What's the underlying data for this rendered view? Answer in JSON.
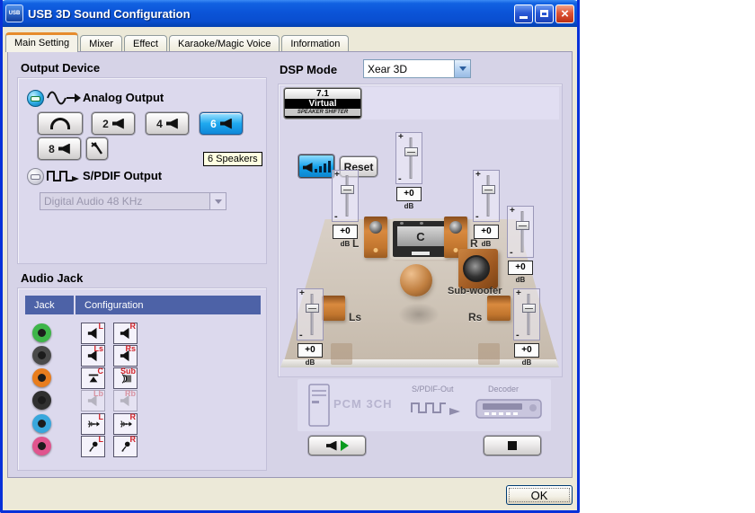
{
  "window": {
    "title": "USB 3D Sound Configuration"
  },
  "tabs": [
    {
      "label": "Main Setting",
      "active": true
    },
    {
      "label": "Mixer"
    },
    {
      "label": "Effect"
    },
    {
      "label": "Karaoke/Magic Voice"
    },
    {
      "label": "Information"
    }
  ],
  "output_device": {
    "heading": "Output Device",
    "analog_label": "Analog Output",
    "speaker_buttons": [
      {
        "icon": "headphone"
      },
      {
        "label": "2"
      },
      {
        "label": "4"
      },
      {
        "label": "6",
        "selected": true
      },
      {
        "label": "8"
      },
      {
        "icon": "settings-wrench"
      }
    ],
    "tooltip": "6 Speakers",
    "spdif_label": "S/PDIF Output",
    "spdif_format": "Digital Audio 48 KHz",
    "spdif_format_disabled": true
  },
  "audio_jack": {
    "heading": "Audio Jack",
    "columns": [
      "Jack",
      "Configuration"
    ],
    "rows": [
      {
        "jack_color": "#3eb549",
        "icons": [
          {
            "type": "speaker",
            "label": "L"
          },
          {
            "type": "speaker",
            "label": "R"
          }
        ]
      },
      {
        "jack_color": "#4a4a4a",
        "icons": [
          {
            "type": "speaker",
            "label": "Ls"
          },
          {
            "type": "speaker",
            "label": "Rs"
          }
        ]
      },
      {
        "jack_color": "#e87d1e",
        "icons": [
          {
            "type": "center-speaker",
            "label": "C"
          },
          {
            "type": "subwoofer",
            "label": "Sub"
          }
        ]
      },
      {
        "jack_color": "#303030",
        "disabled": true,
        "icons": [
          {
            "type": "speaker",
            "label": "Lb"
          },
          {
            "type": "speaker",
            "label": "Rb"
          }
        ]
      },
      {
        "jack_color": "#39a7dc",
        "icons": [
          {
            "type": "line-in",
            "label": "L"
          },
          {
            "type": "line-in",
            "label": "R"
          }
        ]
      },
      {
        "jack_color": "#e0558e",
        "icons": [
          {
            "type": "microphone",
            "label": "L"
          },
          {
            "type": "microphone",
            "label": "R"
          }
        ]
      }
    ]
  },
  "dsp": {
    "label": "DSP Mode",
    "value": "Xear 3D"
  },
  "speaker_shifter": {
    "line1": "7.1",
    "line2": "Virtual",
    "line3": "SPEAKER SHIFTER"
  },
  "controls": {
    "reset": "Reset"
  },
  "room": {
    "labels": {
      "front_left": "L",
      "center": "C",
      "front_right": "R",
      "rear_left": "Ls",
      "rear_right": "Rs",
      "subwoofer": "Sub-woofer"
    },
    "marks": {
      "plus": "+",
      "minus": "-"
    },
    "sliders": [
      {
        "name": "center",
        "value": "+0",
        "unit": "dB"
      },
      {
        "name": "front_left",
        "value": "+0",
        "unit": "dB"
      },
      {
        "name": "front_right",
        "value": "+0",
        "unit": "dB"
      },
      {
        "name": "subwoofer",
        "value": "+0",
        "unit": "dB"
      },
      {
        "name": "rear_left",
        "value": "+0",
        "unit": "dB"
      },
      {
        "name": "rear_right",
        "value": "+0",
        "unit": "dB"
      }
    ]
  },
  "spdif_out": {
    "pcm": "PCM 3CH",
    "out_label": "S/PDIF-Out",
    "decoder": "Decoder"
  },
  "footer": {
    "ok_label": "OK"
  },
  "colors": {
    "titlebar_blue": "#0b54d8",
    "window_border": "#0831d9",
    "page_lavender": "#d6d3e7",
    "panel_lavender": "#dcd9ed",
    "table_header_blue": "#4d62a7",
    "selected_speaker_blue": "#18a8f0",
    "tooltip_bg": "#ffffe1",
    "dialog_bg": "#ece9d8"
  }
}
